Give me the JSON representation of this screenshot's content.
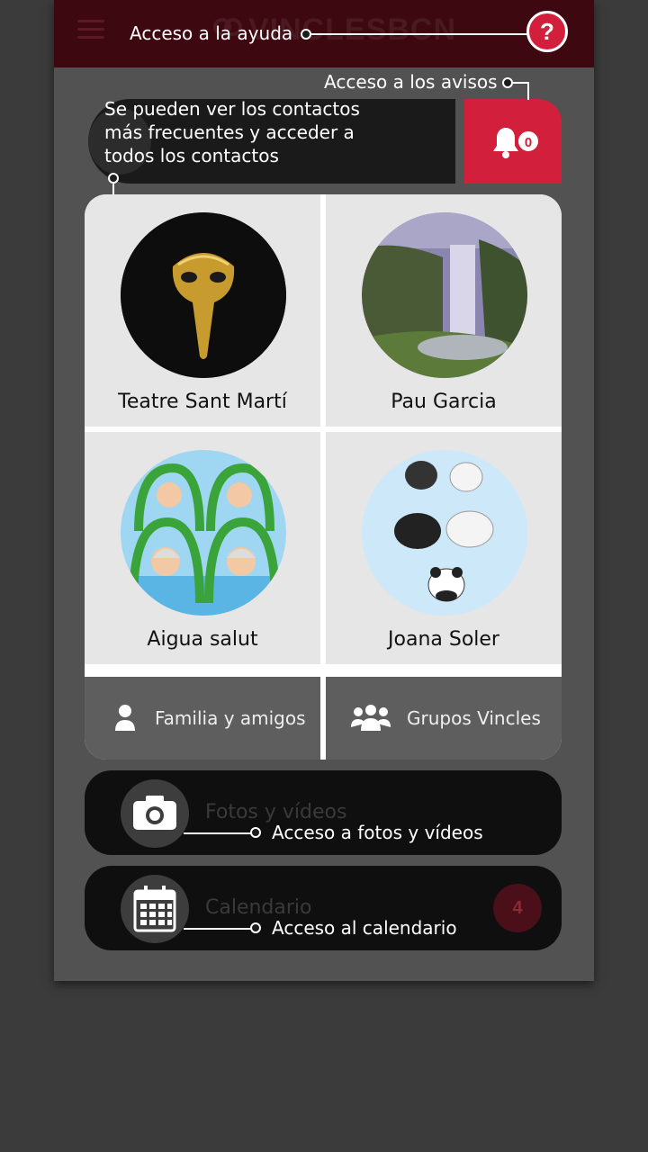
{
  "header": {
    "app_name": "VINCLESBCN",
    "help_label": "?"
  },
  "callouts": {
    "help": "Acceso a la ayuda",
    "alerts": "Acceso a los avisos",
    "contacts_line1": "Se pueden ver los contactos",
    "contacts_line2": "más frecuentes y acceder a",
    "contacts_line3": "todos los contactos",
    "photos": "Acceso a fotos y vídeos",
    "calendar": "Acceso al calendario"
  },
  "alerts": {
    "count": "0"
  },
  "contacts": [
    {
      "name": "Teatre Sant Martí",
      "avatar": "gold-mask-icon"
    },
    {
      "name": "Pau Garcia",
      "avatar": "waterfall-landscape"
    },
    {
      "name": "Aigua salut",
      "avatar": "swimmers-illustration"
    },
    {
      "name": "Joana Soler",
      "avatar": "bears-illustration"
    }
  ],
  "buttons": {
    "family": "Familia y amigos",
    "groups": "Grupos Vincles"
  },
  "menu": {
    "photos": "Fotos y vídeos",
    "calendar": "Calendario",
    "calendar_badge": "4"
  },
  "colors": {
    "accent": "#d21f3b",
    "header": "#3d0810",
    "background": "#3b3b3b"
  }
}
